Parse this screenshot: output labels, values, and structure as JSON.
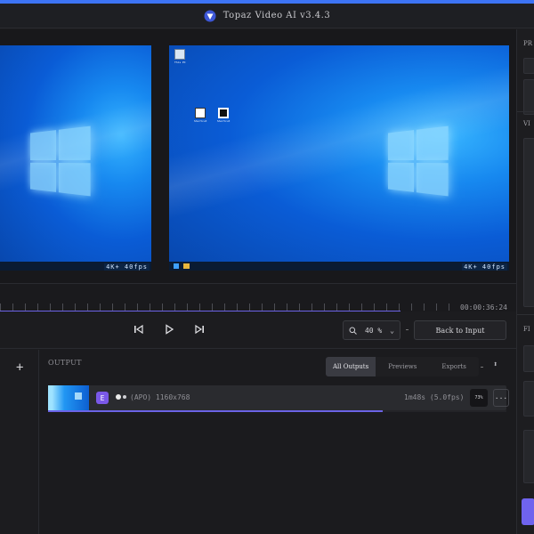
{
  "window": {
    "title": "Topaz Video AI  v3.4.3",
    "accent": "#3d74f5"
  },
  "viewer": {
    "left_frame": {
      "watermark": "4K+ 40fps"
    },
    "right_frame": {
      "watermark": "4K+ 40fps",
      "desktop_icons": [
        {
          "name": "this-pc",
          "label": "This PC"
        },
        {
          "name": "app-shortcut",
          "label": "Shortcut"
        },
        {
          "name": "qr-shortcut",
          "label": "Shortcut"
        }
      ]
    }
  },
  "timeline": {
    "timecode": "00:00:36:24",
    "progress_fraction": 0.78
  },
  "transport": {
    "zoom_value": "40 %",
    "back_to_input": "Back to Input"
  },
  "left_strip": {
    "add_symbol": "+"
  },
  "output": {
    "label": "OUTPUT",
    "tabs": [
      {
        "label": "All Outputs",
        "active": true
      },
      {
        "label": "Previews",
        "active": false
      },
      {
        "label": "Exports",
        "active": false
      }
    ],
    "rows": [
      {
        "model_letter": "E",
        "info": "(APO) 1160x768",
        "eta": "1m48s (5.0fps)",
        "percent": "73%",
        "more": "···",
        "progress_fraction": 0.73
      }
    ]
  },
  "right_panel": {
    "heads": [
      "PR",
      "VI",
      "FI"
    ]
  },
  "colors": {
    "brand_purple": "#6b63e6",
    "model_badge": "#7a58e8",
    "panel": "#1c1c1f"
  }
}
